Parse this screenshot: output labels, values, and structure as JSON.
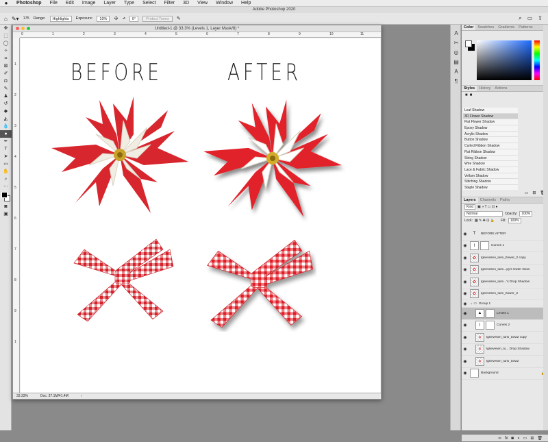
{
  "menubar": {
    "apple": "",
    "app": "Photoshop",
    "items": [
      "File",
      "Edit",
      "Image",
      "Layer",
      "Type",
      "Select",
      "Filter",
      "3D",
      "View",
      "Window",
      "Help"
    ]
  },
  "window_title": "Adobe Photoshop 2020",
  "options": {
    "brush_size": "175",
    "range_label": "Range:",
    "range_value": "Highlights",
    "exposure_label": "Exposure:",
    "exposure_value": "10%",
    "angle_value": "0°",
    "protect_tones": "Protect Tones"
  },
  "document": {
    "title": "Untitled-1 @ 33.3% (Levels 1, Layer Mask/8) *",
    "zoom": "33.33%",
    "doc_size": "Doc: 37.1M/41.4M",
    "ruler_h": [
      "0",
      "1",
      "2",
      "3",
      "4",
      "5",
      "6",
      "7",
      "8",
      "9",
      "10",
      "11"
    ],
    "ruler_v": [
      "1",
      "2",
      "3",
      "4",
      "5",
      "6",
      "7",
      "8",
      "9",
      "1"
    ]
  },
  "canvas": {
    "before": "BEFORE",
    "after": "AFTER"
  },
  "colors": {
    "flower_red": "#d8262e",
    "petal_white": "#f1ede2",
    "ribbon_red": "#d8202a"
  },
  "color_panel": {
    "tabs": [
      "Color",
      "Swatches",
      "Gradients",
      "Patterns"
    ]
  },
  "styles_panel": {
    "tabs": [
      "Styles",
      "History",
      "Actions"
    ],
    "items": [
      "Leaf Shadow",
      "3D Flower Shadow",
      "Flat Flower Shadow",
      "Epoxy Shadow",
      "Acrylic Shadow",
      "Button Shadow",
      "Curled Ribbon Shadow",
      "Flat Ribbon Shadow",
      "String Shadow",
      "Wire Shadow",
      "Lace & Fabric Shadow",
      "Vellum Shadow",
      "Stitching Shadow",
      "Staple Shadow"
    ],
    "selected_index": 1
  },
  "layers_panel": {
    "tabs": [
      "Layers",
      "Channels",
      "Paths"
    ],
    "kind": "Kind",
    "blend_mode": "Normal",
    "opacity_label": "Opacity:",
    "opacity_value": "100%",
    "lock_label": "Lock:",
    "fill_label": "Fill:",
    "fill_value": "100%",
    "layers": [
      {
        "name": "BEFORE            AFTER",
        "thumb": "T",
        "mask": false,
        "fx": false,
        "sel": false
      },
      {
        "name": "Curves 1",
        "thumb": "",
        "mask": true,
        "fx": false,
        "sel": false
      },
      {
        "name": "lgrievesen_lumi_flower_2 copy",
        "thumb": "✿",
        "mask": false,
        "fx": false,
        "sel": false
      },
      {
        "name": "lgrievesen_lumi...py's Outer Glow",
        "thumb": "✿",
        "mask": false,
        "fx": true,
        "sel": false
      },
      {
        "name": "lgrievesen_lumi...'s Drop Shadow",
        "thumb": "✿",
        "mask": false,
        "fx": true,
        "sel": false
      },
      {
        "name": "lgrievesen_lumi_flower_2",
        "thumb": "✿",
        "mask": false,
        "fx": false,
        "sel": false
      },
      {
        "name": "Group 1",
        "thumb": "▭",
        "mask": false,
        "fx": false,
        "sel": false
      },
      {
        "name": "Levels 1",
        "thumb": "▲",
        "mask": true,
        "fx": false,
        "sel": true
      },
      {
        "name": "Curves 2",
        "thumb": "",
        "mask": true,
        "fx": false,
        "sel": false
      },
      {
        "name": "lgrievesen_lumi_bow2 copy",
        "thumb": "✕",
        "mask": false,
        "fx": false,
        "sel": false
      },
      {
        "name": "lgrievesen_lu... Drop Shadow",
        "thumb": "✕",
        "mask": false,
        "fx": true,
        "sel": false
      },
      {
        "name": "lgrievesen_lumi_bow2",
        "thumb": "✕",
        "mask": false,
        "fx": false,
        "sel": false
      },
      {
        "name": "Background",
        "thumb": "",
        "mask": false,
        "fx": false,
        "sel": false
      }
    ]
  }
}
